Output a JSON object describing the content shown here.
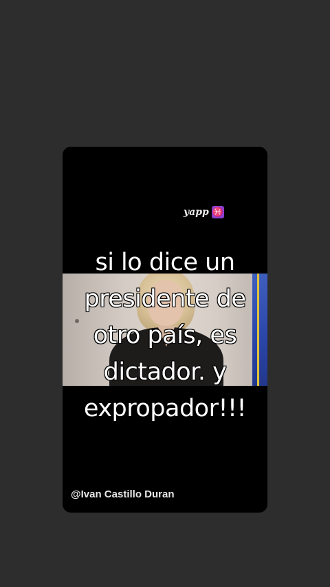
{
  "watermark": {
    "text": "yapp",
    "icon": "pisces-icon",
    "icon_glyph": "♓",
    "icon_color": "#8e3fd1"
  },
  "caption": {
    "lines": [
      "si lo dice un",
      "presidente de",
      "otro país, es",
      "dictador. y",
      "expropador!!!"
    ]
  },
  "handle": "@Ivan Castillo Duran",
  "colors": {
    "background": "#2e2d2d",
    "video_card": "#000000",
    "caption_text": "#ffffff"
  }
}
